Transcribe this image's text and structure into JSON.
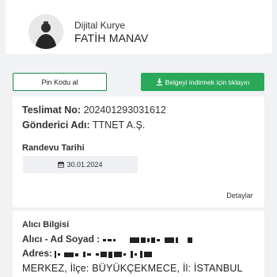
{
  "courier": {
    "role": "Dijital Kurye",
    "name": "FATİH MANAV"
  },
  "actions": {
    "pin_label": "Pin Kodu al",
    "download_label": "Belgeyi indirmek için tıklayın",
    "download_icon": "download-icon"
  },
  "shipment": {
    "tracking_key": "Teslimat No:",
    "tracking_value": "202401293031612",
    "sender_key": "Gönderici Adı:",
    "sender_value": "TTNET A.Ş."
  },
  "appointment": {
    "title": "Randevu Tarihi",
    "date": "30.01.2024",
    "calendar_icon": "calendar-icon"
  },
  "details_label": "Detaylar",
  "recipient": {
    "title": "Alıcı Bilgisi",
    "name_key": "Alıcı - Ad Soyad :",
    "address_key": "Adres:",
    "address_tail": "MERKEZ, İlçe: BÜYÜKÇEKMECE, İl: İSTANBUL"
  },
  "colors": {
    "accent_green": "#2aa95a",
    "border_green": "#1f8a4c"
  }
}
